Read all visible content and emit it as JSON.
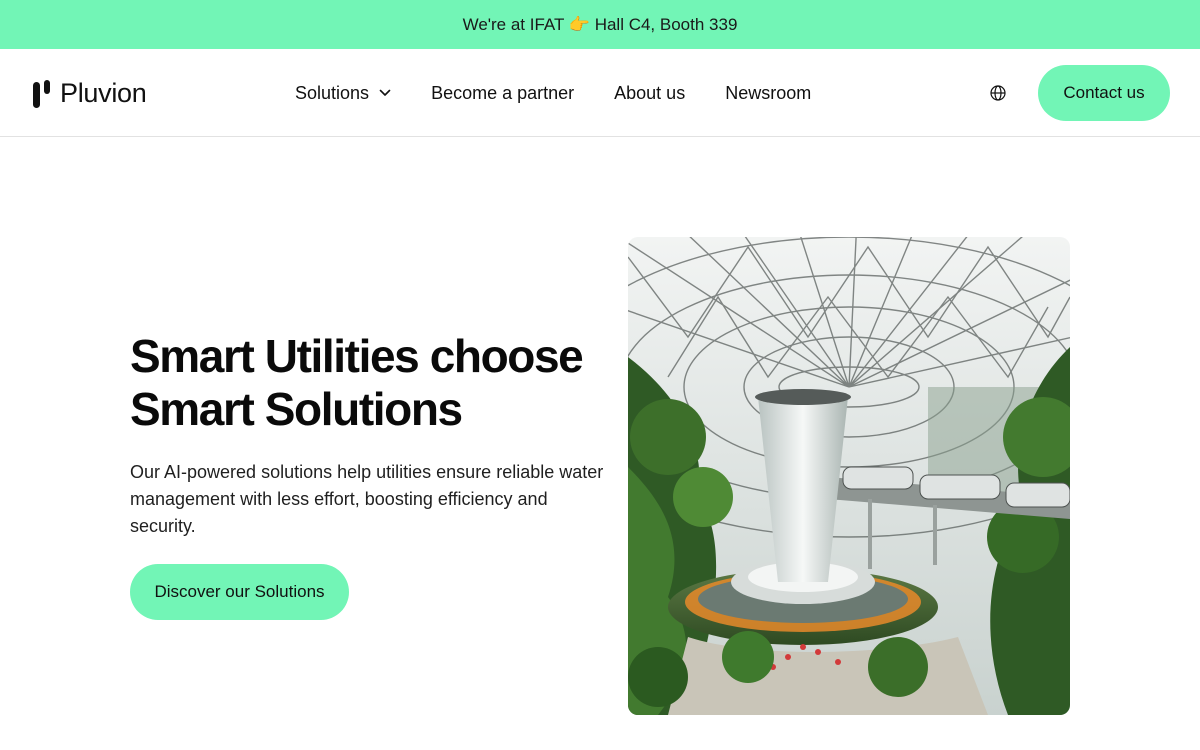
{
  "announcement": {
    "text": "We're at IFAT 👉 Hall C4, Booth 339"
  },
  "header": {
    "logo_text": "Pluvion",
    "logo_icon": "pluvion-logo-icon",
    "nav": {
      "solutions": "Solutions",
      "partner": "Become a partner",
      "about": "About us",
      "newsroom": "Newsroom"
    },
    "language_icon": "globe-icon",
    "contact_label": "Contact us"
  },
  "hero": {
    "title_line1": "Smart Utilities choose",
    "title_line2": "Smart Solutions",
    "description": "Our AI-powered solutions help utilities ensure reliable water management with less effort, boosting efficiency and security.",
    "cta_label": "Discover our Solutions",
    "image_subject": "indoor-waterfall-glass-dome-photo"
  },
  "colors": {
    "accent": "#72f5b6",
    "text": "#111111",
    "background": "#ffffff",
    "divider": "#e2e2e2"
  }
}
